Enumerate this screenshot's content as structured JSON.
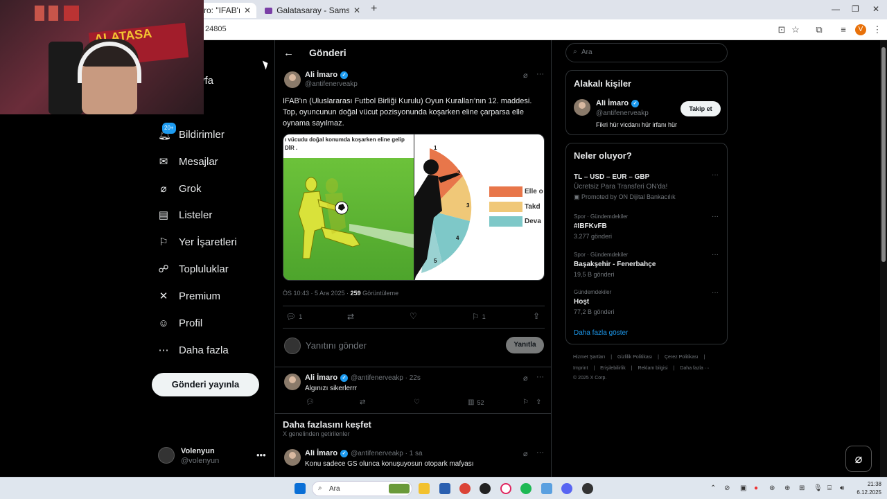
{
  "browser": {
    "tabs": [
      {
        "label": "ro: \"IFAB'ın (Ulu",
        "close": "✕"
      },
      {
        "label": "Galatasaray - Samsunspor Maç",
        "close": "✕"
      }
    ],
    "new_tab": "+",
    "url": "24805",
    "window_controls": [
      "—",
      "❐",
      "✕"
    ],
    "profile_initial": "V"
  },
  "webcam": {
    "banner_text": "ALATASA"
  },
  "nav": {
    "partial_home": "yfa",
    "notifications_badge": "20+",
    "items": [
      {
        "label": "Bildirimler",
        "icon": "bell-icon"
      },
      {
        "label": "Mesajlar",
        "icon": "mail-icon"
      },
      {
        "label": "Grok",
        "icon": "grok-icon"
      },
      {
        "label": "Listeler",
        "icon": "list-icon"
      },
      {
        "label": "Yer İşaretleri",
        "icon": "bookmark-icon"
      },
      {
        "label": "Topluluklar",
        "icon": "communities-icon"
      },
      {
        "label": "Premium",
        "icon": "x-logo-icon"
      },
      {
        "label": "Profil",
        "icon": "profile-icon"
      },
      {
        "label": "Daha fazla",
        "icon": "more-icon"
      }
    ],
    "post_button": "Gönderi yayınla",
    "account": {
      "name": "Volenyun",
      "handle": "@volenyun",
      "menu": "•••"
    }
  },
  "main": {
    "title": "Gönderi",
    "tweet": {
      "author": "Ali İmaro",
      "handle": "@antifenerveakp",
      "text": "IFAB'ın (Uluslararası Futbol Birliği Kurulu) Oyun Kuralları'nın 12. maddesi. Top, oyuncunun doğal vücut pozisyonunda koşarken eline çarparsa elle oynama sayılmaz.",
      "image_caption": "ı vücudu doğal konumda koşarken eline gelip DİR .",
      "chart_labels": [
        "Elle o",
        "Takd",
        "Deva"
      ],
      "chart_numbers": [
        "1",
        "2",
        "3",
        "4",
        "5"
      ],
      "time": "ÖS 10:43 · 5 Ara 2025 ·",
      "views_count": "259",
      "views_label": "Görüntüleme",
      "replies": "1",
      "bookmarks": "1"
    },
    "reply_box": {
      "placeholder": "Yanıtını gönder",
      "button": "Yanıtla"
    },
    "reply": {
      "author": "Ali İmaro",
      "handle": "@antifenerveakp · 22s",
      "text": "Algınızı sikerlerrr",
      "views": "52"
    },
    "discover": {
      "title": "Daha fazlasını keşfet",
      "subtitle": "X genelinden getirilenler"
    },
    "next_post": {
      "author": "Ali İmaro",
      "handle": "@antifenerveakp · 1 sa",
      "text": "Konu sadece GS olunca konuşuyosun otopark mafyası"
    }
  },
  "right": {
    "search_placeholder": "Ara",
    "related": {
      "title": "Alakalı kişiler",
      "name": "Ali İmaro",
      "handle": "@antifenerveakp",
      "bio": "Fikri hür vicdanı hür irfanı hür",
      "follow": "Takip et"
    },
    "trends": {
      "title": "Neler oluyor?",
      "items": [
        {
          "context": "",
          "name": "TL – USD – EUR – GBP",
          "sub": "Ücretsiz Para Transferi ON'da!",
          "count": "Promoted by ON Dijital Bankacılık"
        },
        {
          "context": "Spor · Gündemdekiler",
          "name": "#IBFKvFB",
          "sub": "",
          "count": "3.277 gönderi"
        },
        {
          "context": "Spor · Gündemdekiler",
          "name": "Başakşehir - Fenerbahçe",
          "sub": "",
          "count": "19,5 B gönderi"
        },
        {
          "context": "Gündemdekiler",
          "name": "Hoşt",
          "sub": "",
          "count": "77,2 B gönderi"
        }
      ],
      "show_more": "Daha fazla göster"
    },
    "footer": {
      "line1": [
        "Hizmet Şartları",
        "Gizlilik Politikası",
        "Çerez Politikası"
      ],
      "line2": [
        "Imprint",
        "Erişilebilirlik",
        "Reklam bilgisi",
        "Daha fazla ···"
      ],
      "copyright": "© 2025 X Corp."
    }
  },
  "taskbar": {
    "search_placeholder": "Ara",
    "time": "21:38",
    "date": "6.12.2025"
  }
}
